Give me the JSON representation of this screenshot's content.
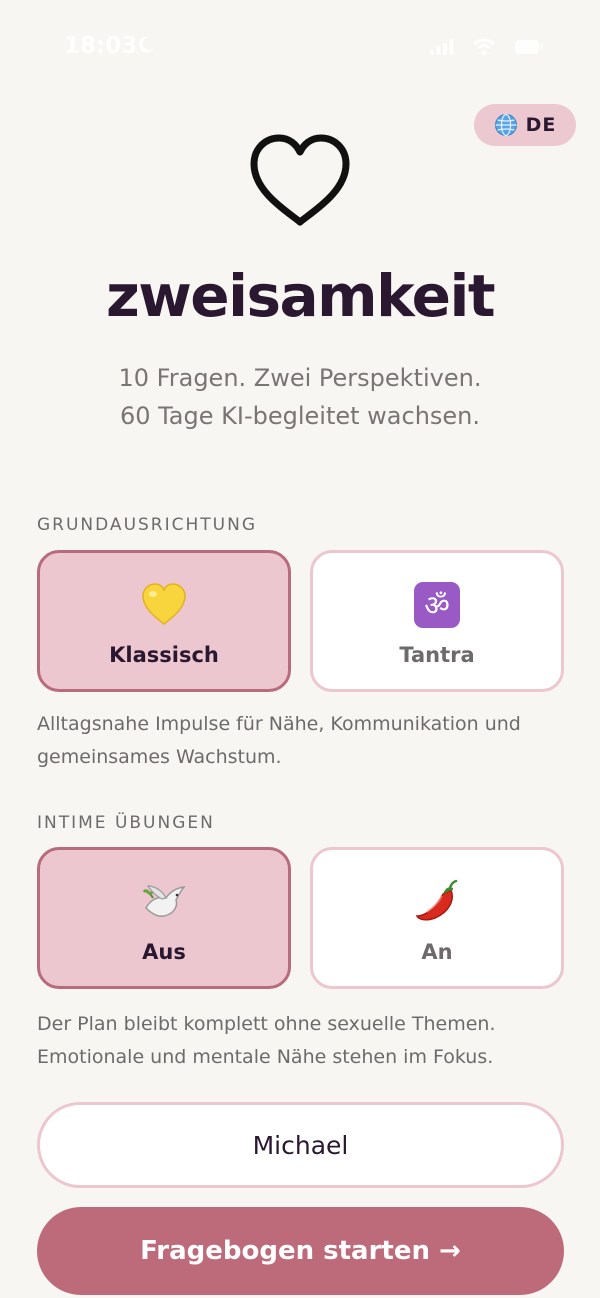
{
  "status_bar": {
    "time": "18:03"
  },
  "language": {
    "code": "DE",
    "icon": "globe-icon"
  },
  "header": {
    "icon": "heart-outline-icon",
    "title": "zweisamkeit",
    "subtitle_line1": "10 Fragen. Zwei Perspektiven.",
    "subtitle_line2": "60 Tage KI-begleitet wachsen."
  },
  "orientation": {
    "label": "GRUNDAUSRICHTUNG",
    "options": [
      {
        "label": "Klassisch",
        "icon": "yellow-heart-emoji",
        "selected": true
      },
      {
        "label": "Tantra",
        "icon": "om-emoji",
        "selected": false
      }
    ],
    "description_line1": "Alltagsnahe Impulse für Nähe, Kommunikation und",
    "description_line2": "gemeinsames Wachstum."
  },
  "intimate": {
    "label": "INTIME ÜBUNGEN",
    "options": [
      {
        "label": "Aus",
        "icon": "dove-emoji",
        "selected": true
      },
      {
        "label": "An",
        "icon": "chili-pepper-emoji",
        "selected": false
      }
    ],
    "description_line1": "Der Plan bleibt komplett ohne sexuelle Themen.",
    "description_line2": "Emotionale und mentale Nähe stehen im Fokus."
  },
  "name_input": {
    "value": "Michael"
  },
  "start_button": {
    "label": "Fragebogen starten →"
  },
  "colors": {
    "background": "#f8f6f3",
    "accent": "#bd6a7a",
    "selected_fill": "#ecc7cf",
    "selected_border": "#b86b7b",
    "title": "#2a1730"
  }
}
